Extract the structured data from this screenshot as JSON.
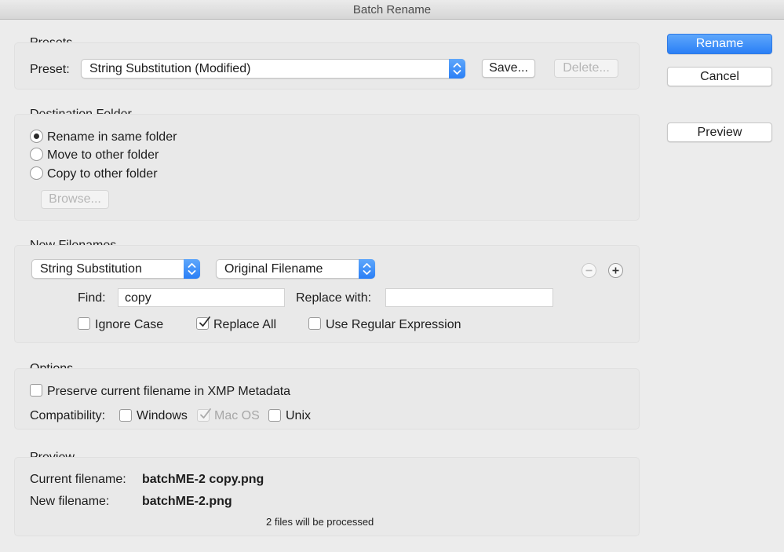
{
  "window": {
    "title": "Batch Rename"
  },
  "actions": {
    "rename": "Rename",
    "cancel": "Cancel",
    "preview": "Preview"
  },
  "presets": {
    "title": "Presets",
    "label": "Preset:",
    "selected": "String Substitution (Modified)",
    "save": "Save...",
    "delete": "Delete..."
  },
  "destination": {
    "title": "Destination Folder",
    "options": [
      "Rename in same folder",
      "Move to other folder",
      "Copy to other folder"
    ],
    "selected_index": 0,
    "browse": "Browse..."
  },
  "new_filenames": {
    "title": "New Filenames",
    "method": "String Substitution",
    "source": "Original Filename",
    "find_label": "Find:",
    "find_value": "copy",
    "replace_label": "Replace with:",
    "replace_value": "",
    "ignore_case": {
      "label": "Ignore Case",
      "checked": false
    },
    "replace_all": {
      "label": "Replace All",
      "checked": true
    },
    "use_regex": {
      "label": "Use Regular Expression",
      "checked": false
    }
  },
  "options": {
    "title": "Options",
    "preserve": {
      "label": "Preserve current filename in XMP Metadata",
      "checked": false
    },
    "compat_label": "Compatibility:",
    "windows": {
      "label": "Windows",
      "checked": false
    },
    "macos": {
      "label": "Mac OS",
      "checked": true,
      "disabled": true
    },
    "unix": {
      "label": "Unix",
      "checked": false
    }
  },
  "preview": {
    "title": "Preview",
    "current_label": "Current filename:",
    "current_value": "batchME-2 copy.png",
    "new_label": "New filename:",
    "new_value": "batchME-2.png",
    "status": "2 files will be processed"
  },
  "colors": {
    "accent": "#2a7ff6",
    "window_bg": "#ececec"
  }
}
